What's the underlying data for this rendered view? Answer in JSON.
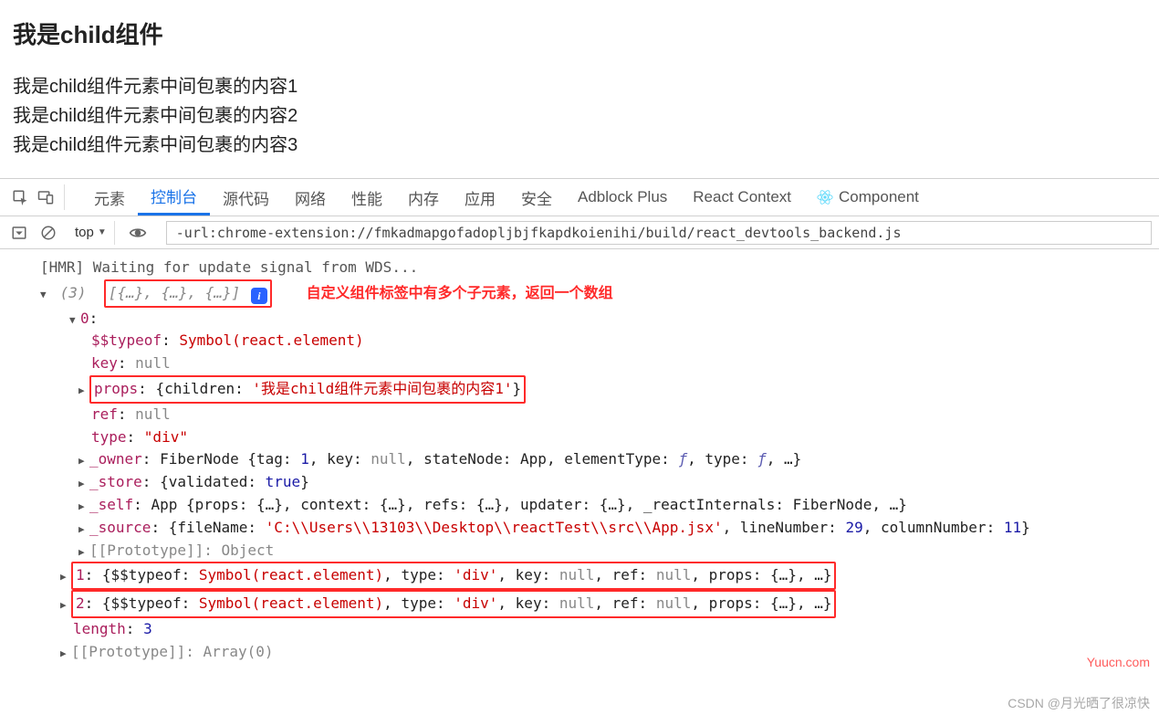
{
  "page": {
    "title": "我是child组件",
    "lines": [
      "我是child组件元素中间包裹的内容1",
      "我是child组件元素中间包裹的内容2",
      "我是child组件元素中间包裹的内容3"
    ]
  },
  "tabs": {
    "elements": "元素",
    "console": "控制台",
    "sources": "源代码",
    "network": "网络",
    "performance": "性能",
    "memory": "内存",
    "application": "应用",
    "security": "安全",
    "adblock": "Adblock Plus",
    "reactctx": "React Context",
    "components": "Component"
  },
  "filter": {
    "context": "top",
    "input": "-url:chrome-extension://fmkadmapgofadopljbjfkapdkoienihi/build/react_devtools_backend.js"
  },
  "console": {
    "hmr": "[HMR] Waiting for update signal from WDS...",
    "arr_len_label": "(3)",
    "arr_preview": "[{…}, {…}, {…}]",
    "info": "i",
    "annotation": "自定义组件标签中有多个子元素，返回一个数组",
    "idx0": "0",
    "typeof_key": "$$typeof",
    "typeof_val": "Symbol(react.element)",
    "key_key": "key",
    "null": "null",
    "props_key": "props",
    "props_children": "children",
    "props_str": "'我是child组件元素中间包裹的内容1'",
    "ref_key": "ref",
    "type_key": "type",
    "type_val": "\"div\"",
    "owner_key": "_owner",
    "owner_pre": "FiberNode {tag: ",
    "owner_tag": "1",
    "owner_k2": ", key: ",
    "owner_k3": ", stateNode: ",
    "owner_sn": "App",
    "owner_k4": ", elementType: ",
    "owner_k5": ", type: ",
    "owner_tail": ", …}",
    "f": "ƒ",
    "store_key": "_store",
    "store_val": "{validated: ",
    "store_true": "true",
    "store_tail": "}",
    "self_key": "_self",
    "self_val": "App {props: {…}, context: {…}, refs: {…}, updater: {…}, _reactInternals: FiberNode, …}",
    "source_key": "_source",
    "source_pre": "{fileName: ",
    "source_fn": "'C:\\\\Users\\\\13103\\\\Desktop\\\\reactTest\\\\src\\\\App.jsx'",
    "source_ln_k": ", lineNumber: ",
    "source_ln": "29",
    "source_cn_k": ", columnNumber: ",
    "source_cn": "11",
    "source_tail": "}",
    "proto_inner": "[[Prototype]]: Object",
    "idx1": "1",
    "idx2": "2",
    "item_pre": "{$$typeof: ",
    "item_sym": "Symbol(react.element)",
    "item_type_k": ", type: ",
    "item_type_v": "'div'",
    "item_key_k": ", key: ",
    "item_ref_k": ", ref: ",
    "item_props_k": ", props: ",
    "item_props_v": "{…}",
    "item_tail": ", …}",
    "length_k": "length",
    "length_v": "3",
    "proto_outer": "[[Prototype]]: Array(0)"
  },
  "wm1": "Yuucn.com",
  "wm2": "CSDN @月光晒了很凉快"
}
